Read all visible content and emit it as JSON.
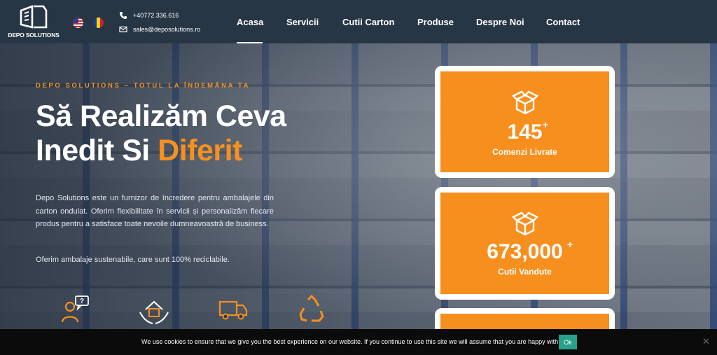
{
  "header": {
    "logo_text": "DEPO SOLUTIONS",
    "languages": [
      "en",
      "ro"
    ],
    "phone": "+40772.336.616",
    "email": "sales@deposolutions.ro",
    "nav": [
      "Acasa",
      "Servicii",
      "Cutii Carton",
      "Produse",
      "Despre Noi",
      "Contact"
    ],
    "active_nav": "Acasa"
  },
  "hero": {
    "tagline": "DEPO SOLUTIONS – TOTUL LA ÎNDEMÂNA TA",
    "title_line1": "Să Realizăm Ceva",
    "title_line2_a": "Inedit Si ",
    "title_line2_b": "Diferit",
    "description": "Depo Solutions este un furnizor de încredere pentru ambalajele din carton ondulat. Oferim flexibilitate în servicii și personalizăm fiecare produs pentru a satisface toate nevoile dumneavoastră de business.",
    "description2": "Oferim ambalaje sustenabile, care sunt 100% reciclabile.",
    "feature_icons": [
      "support-icon",
      "home-care-icon",
      "delivery-truck-icon",
      "recycle-icon"
    ]
  },
  "stats": [
    {
      "icon": "box-icon",
      "value": "145",
      "suffix": "+",
      "label": "Comenzi Livrate"
    },
    {
      "icon": "box-icon",
      "value": "673,000",
      "suffix": "+",
      "label": "Cutii Vandute"
    }
  ],
  "cookie": {
    "text": "We use cookies to ensure that we give you the best experience on our website. If you continue to use this site we will assume that you are happy with it.",
    "ok_label": "Ok",
    "close_label": "✕"
  },
  "colors": {
    "accent": "#f7901e",
    "header_bg": "#273645",
    "cookie_ok": "#27a189"
  }
}
